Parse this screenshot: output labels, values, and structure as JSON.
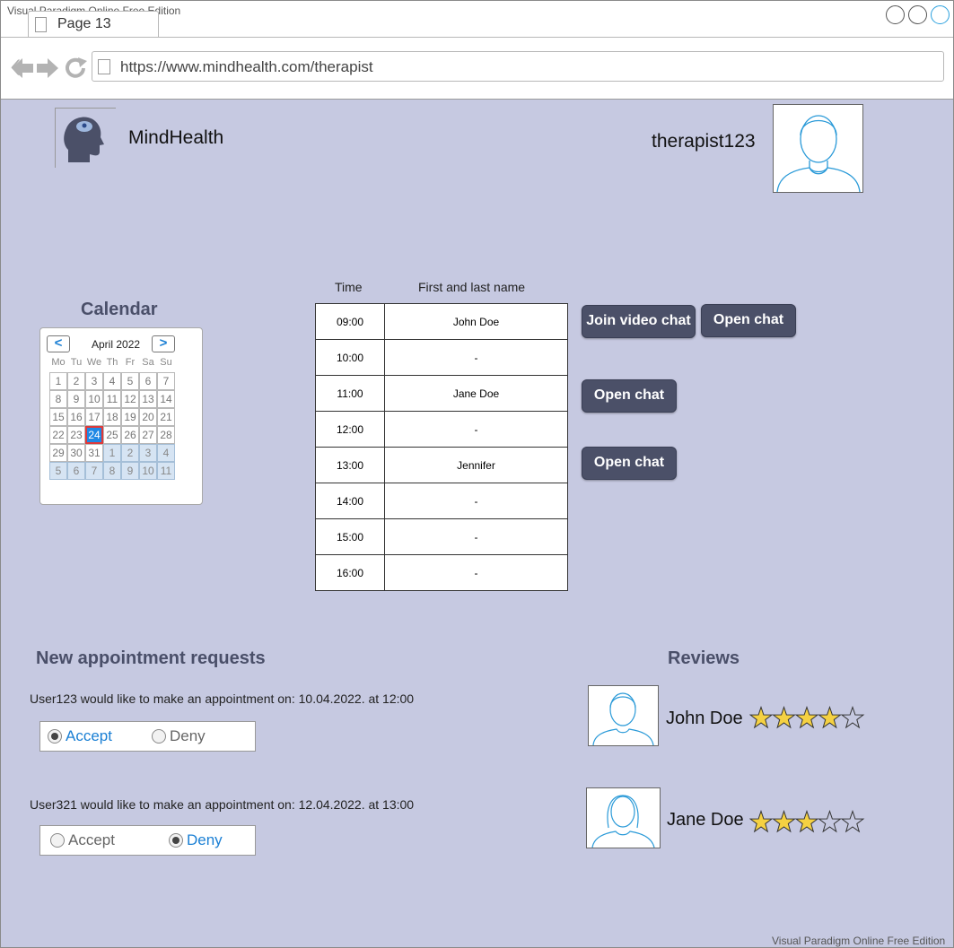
{
  "watermark": "Visual Paradigm Online Free Edition",
  "browser": {
    "tab_label": "Page 13",
    "url": "https://www.mindhealth.com/therapist"
  },
  "header": {
    "brand": "MindHealth",
    "username": "therapist123"
  },
  "calendar": {
    "title": "Calendar",
    "month_label": "April 2022",
    "prev_label": "<",
    "next_label": ">",
    "weekdays": [
      "Mo",
      "Tu",
      "We",
      "Th",
      "Fr",
      "Sa",
      "Su"
    ],
    "selected_day": "24",
    "weeks": [
      [
        "1",
        "2",
        "3",
        "4",
        "5",
        "6",
        "7"
      ],
      [
        "8",
        "9",
        "10",
        "11",
        "12",
        "13",
        "14"
      ],
      [
        "15",
        "16",
        "17",
        "18",
        "19",
        "20",
        "21"
      ],
      [
        "22",
        "23",
        "24",
        "25",
        "26",
        "27",
        "28"
      ],
      [
        "29",
        "30",
        "31",
        "1",
        "2",
        "3",
        "4"
      ],
      [
        "5",
        "6",
        "7",
        "8",
        "9",
        "10",
        "11"
      ]
    ]
  },
  "schedule": {
    "headers": {
      "time": "Time",
      "name": "First and last name"
    },
    "rows": [
      {
        "time": "09:00",
        "name": "John Doe"
      },
      {
        "time": "10:00",
        "name": "-"
      },
      {
        "time": "11:00",
        "name": "Jane Doe"
      },
      {
        "time": "12:00",
        "name": "-"
      },
      {
        "time": "13:00",
        "name": "Jennifer"
      },
      {
        "time": "14:00",
        "name": "-"
      },
      {
        "time": "15:00",
        "name": "-"
      },
      {
        "time": "16:00",
        "name": "-"
      }
    ],
    "actions": {
      "join_video_chat": "Join video chat",
      "open_chat": "Open chat"
    }
  },
  "appointments": {
    "title": "New appointment requests",
    "requests": [
      {
        "text": "User123 would like to make an appointment on: 10.04.2022. at 12:00",
        "accept": "Accept",
        "deny": "Deny",
        "selected": "accept"
      },
      {
        "text": "User321 would like to make an appointment on: 12.04.2022. at 13:00",
        "accept": "Accept",
        "deny": "Deny",
        "selected": "deny"
      }
    ]
  },
  "reviews": {
    "title": "Reviews",
    "items": [
      {
        "name": "John Doe",
        "rating": 4,
        "max": 5
      },
      {
        "name": "Jane Doe",
        "rating": 3,
        "max": 5
      }
    ]
  },
  "colors": {
    "page_background": "#c6c9e1",
    "button": "#4b5068",
    "heading": "#4a4f69",
    "link_blue": "#1a7fd4",
    "star_fill": "#f5d142"
  }
}
